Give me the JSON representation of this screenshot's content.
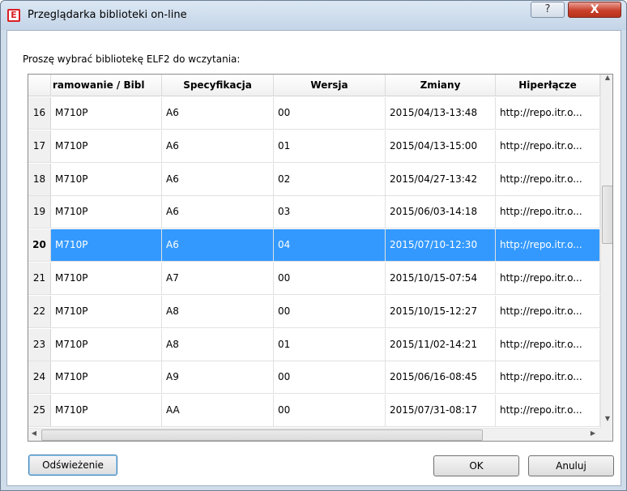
{
  "window": {
    "title": "Przeglądarka biblioteki on-line",
    "app_icon": "E",
    "help_label": "?",
    "close_label": "X"
  },
  "prompt": "Proszę wybrać bibliotekę ELF2 do wczytania:",
  "table": {
    "columns": [
      "ramowanie / Bibl",
      "Specyfikacja",
      "Wersja",
      "Zmiany",
      "Hiperłącze"
    ],
    "selected_row": 20,
    "rows": [
      {
        "num": "16",
        "lib": "M710P",
        "spec": "A6",
        "ver": "00",
        "changes": "2015/04/13-13:48",
        "link": "http://repo.itr.o..."
      },
      {
        "num": "17",
        "lib": "M710P",
        "spec": "A6",
        "ver": "01",
        "changes": "2015/04/13-15:00",
        "link": "http://repo.itr.o..."
      },
      {
        "num": "18",
        "lib": "M710P",
        "spec": "A6",
        "ver": "02",
        "changes": "2015/04/27-13:42",
        "link": "http://repo.itr.o..."
      },
      {
        "num": "19",
        "lib": "M710P",
        "spec": "A6",
        "ver": "03",
        "changes": "2015/06/03-14:18",
        "link": "http://repo.itr.o..."
      },
      {
        "num": "20",
        "lib": "M710P",
        "spec": "A6",
        "ver": "04",
        "changes": "2015/07/10-12:30",
        "link": "http://repo.itr.o..."
      },
      {
        "num": "21",
        "lib": "M710P",
        "spec": "A7",
        "ver": "00",
        "changes": "2015/10/15-07:54",
        "link": "http://repo.itr.o..."
      },
      {
        "num": "22",
        "lib": "M710P",
        "spec": "A8",
        "ver": "00",
        "changes": "2015/10/15-12:27",
        "link": "http://repo.itr.o..."
      },
      {
        "num": "23",
        "lib": "M710P",
        "spec": "A8",
        "ver": "01",
        "changes": "2015/11/02-14:21",
        "link": "http://repo.itr.o..."
      },
      {
        "num": "24",
        "lib": "M710P",
        "spec": "A9",
        "ver": "00",
        "changes": "2015/06/16-08:45",
        "link": "http://repo.itr.o..."
      },
      {
        "num": "25",
        "lib": "M710P",
        "spec": "AA",
        "ver": "00",
        "changes": "2015/07/31-08:17",
        "link": "http://repo.itr.o..."
      }
    ]
  },
  "buttons": {
    "refresh": "Odświeżenie",
    "ok": "OK",
    "cancel": "Anuluj"
  },
  "colors": {
    "selection": "#3399ff",
    "close_button": "#c9412b",
    "app_icon": "#d81f26"
  }
}
